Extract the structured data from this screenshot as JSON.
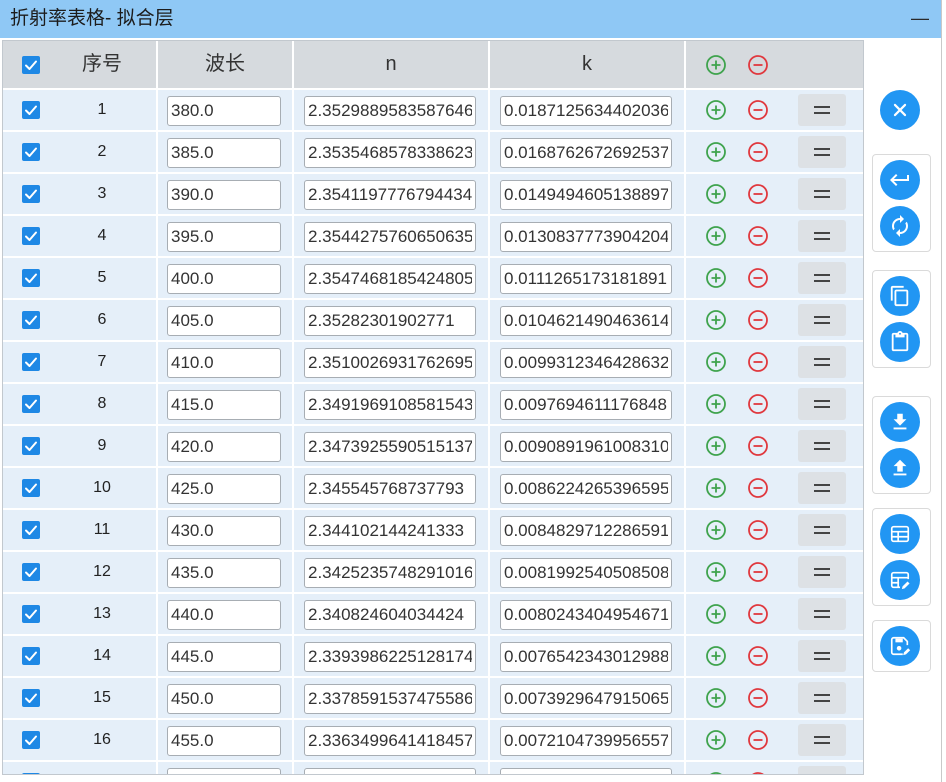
{
  "window": {
    "title": "折射率表格- 拟合层",
    "minimize_label": "—"
  },
  "table": {
    "headers": {
      "index": "序号",
      "wavelength": "波长",
      "n": "n",
      "k": "k"
    },
    "all_checked": true,
    "rows": [
      {
        "index": "1",
        "wavelength": "380.0",
        "n": "2.3529889583587646",
        "k": "0.0187125634402036",
        "checked": true
      },
      {
        "index": "2",
        "wavelength": "385.0",
        "n": "2.3535468578338623",
        "k": "0.0168762672692537",
        "checked": true
      },
      {
        "index": "3",
        "wavelength": "390.0",
        "n": "2.3541197776794434",
        "k": "0.0149494605138897",
        "checked": true
      },
      {
        "index": "4",
        "wavelength": "395.0",
        "n": "2.3544275760650635",
        "k": "0.0130837773904204",
        "checked": true
      },
      {
        "index": "5",
        "wavelength": "400.0",
        "n": "2.3547468185424805",
        "k": "0.0111265173181891",
        "checked": true
      },
      {
        "index": "6",
        "wavelength": "405.0",
        "n": "2.35282301902771",
        "k": "0.0104621490463614",
        "checked": true
      },
      {
        "index": "7",
        "wavelength": "410.0",
        "n": "2.3510026931762695",
        "k": "0.0099312346428632",
        "checked": true
      },
      {
        "index": "8",
        "wavelength": "415.0",
        "n": "2.3491969108581543",
        "k": "0.0097694611176848",
        "checked": true
      },
      {
        "index": "9",
        "wavelength": "420.0",
        "n": "2.3473925590515137",
        "k": "0.0090891961008310",
        "checked": true
      },
      {
        "index": "10",
        "wavelength": "425.0",
        "n": "2.345545768737793",
        "k": "0.0086224265396595",
        "checked": true
      },
      {
        "index": "11",
        "wavelength": "430.0",
        "n": "2.344102144241333",
        "k": "0.0084829712286591",
        "checked": true
      },
      {
        "index": "12",
        "wavelength": "435.0",
        "n": "2.3425235748291016",
        "k": "0.0081992540508508",
        "checked": true
      },
      {
        "index": "13",
        "wavelength": "440.0",
        "n": "2.340824604034424",
        "k": "0.0080243404954671",
        "checked": true
      },
      {
        "index": "14",
        "wavelength": "445.0",
        "n": "2.3393986225128174",
        "k": "0.0076542343012988",
        "checked": true
      },
      {
        "index": "15",
        "wavelength": "450.0",
        "n": "2.3378591537475586",
        "k": "0.0073929647915065",
        "checked": true
      },
      {
        "index": "16",
        "wavelength": "455.0",
        "n": "2.3363499641418457",
        "k": "0.0072104739956557",
        "checked": true
      }
    ]
  },
  "sidebar": {
    "icons": [
      "close-icon",
      "return-icon",
      "refresh-icon",
      "copy-icon",
      "paste-icon",
      "download-icon",
      "upload-icon",
      "table-icon",
      "table-edit-icon",
      "save-icon"
    ]
  },
  "colors": {
    "title_bar": "#8fc8f5",
    "accent": "#2196f3",
    "add": "#3fa34d",
    "remove": "#e0383e",
    "row": "#e5eff9",
    "header": "#d6dade",
    "checkbox": "#1e88e5"
  }
}
